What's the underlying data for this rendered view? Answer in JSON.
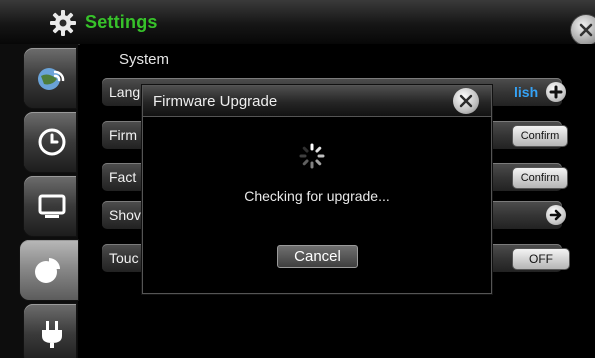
{
  "header": {
    "title": "Settings"
  },
  "section": {
    "label": "System"
  },
  "rows": [
    {
      "label": "Lang",
      "value": "lish",
      "action": ""
    },
    {
      "label": "Firm",
      "value": "",
      "action": "Confirm"
    },
    {
      "label": "Fact",
      "value": "",
      "action": "Confirm"
    },
    {
      "label": "Shov",
      "value": "",
      "action": ""
    },
    {
      "label": "Touc",
      "value": "",
      "action": "OFF"
    }
  ],
  "dialog": {
    "title": "Firmware Upgrade",
    "status": "Checking for upgrade...",
    "cancel_label": "Cancel"
  },
  "colors": {
    "title_green": "#37c22a",
    "language_blue": "#35a2f5",
    "background": "#000000"
  },
  "icons": {
    "header": "gear-icon",
    "close": "close-icon",
    "sidebar": [
      "network-icon",
      "clock-icon",
      "display-icon",
      "pie-chart-icon",
      "power-plug-icon"
    ],
    "row_actions": [
      "plus-icon",
      "arrow-right-icon"
    ]
  },
  "sidebar": {
    "active_index": 3
  }
}
